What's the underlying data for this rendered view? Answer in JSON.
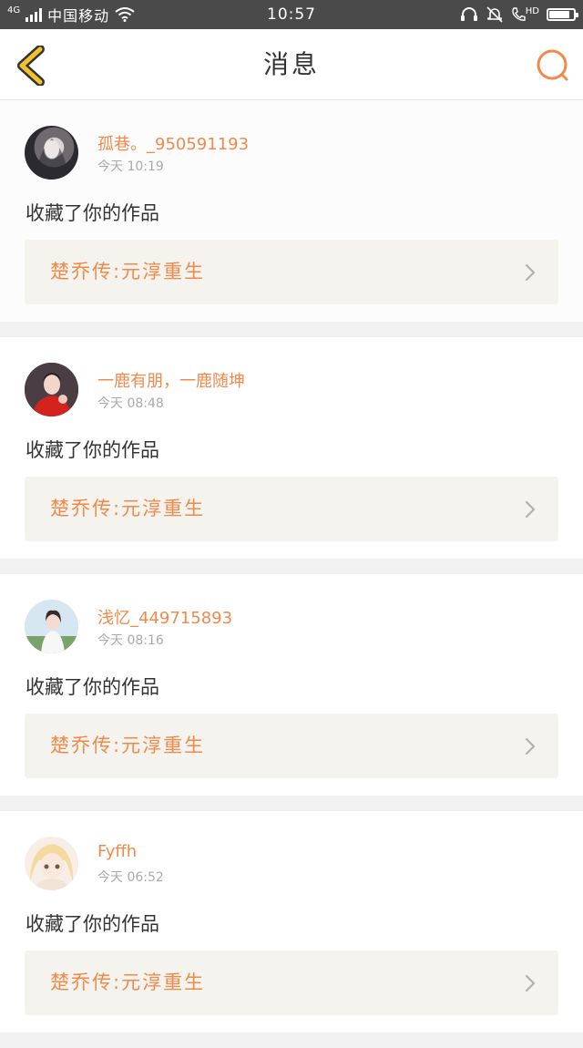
{
  "status_bar": {
    "network": "4G",
    "carrier": "中国移动",
    "time": "10:57",
    "hd": "HD",
    "battery_level": 0.85
  },
  "nav": {
    "title": "消息"
  },
  "colors": {
    "accent": "#f08a4b",
    "back_icon": "#f2c12e",
    "work_bg": "#f4f3ee"
  },
  "messages": [
    {
      "username": "孤巷。_950591193",
      "time": "今天 10:19",
      "action": "收藏了你的作品",
      "work_title": "楚乔传:元淳重生",
      "avatar": "avatar-dark-hair-girl"
    },
    {
      "username": "一鹿有朋，一鹿随坤",
      "time": "今天 08:48",
      "action": "收藏了你的作品",
      "work_title": "楚乔传:元淳重生",
      "avatar": "avatar-red-dress-girl"
    },
    {
      "username": "浅忆_449715893",
      "time": "今天 08:16",
      "action": "收藏了你的作品",
      "work_title": "楚乔传:元淳重生",
      "avatar": "avatar-white-dress-girl"
    },
    {
      "username": "Fyffh",
      "time": "今天 06:52",
      "action": "收藏了你的作品",
      "work_title": "楚乔传:元淳重生",
      "avatar": "avatar-anime-blonde-girl"
    }
  ]
}
